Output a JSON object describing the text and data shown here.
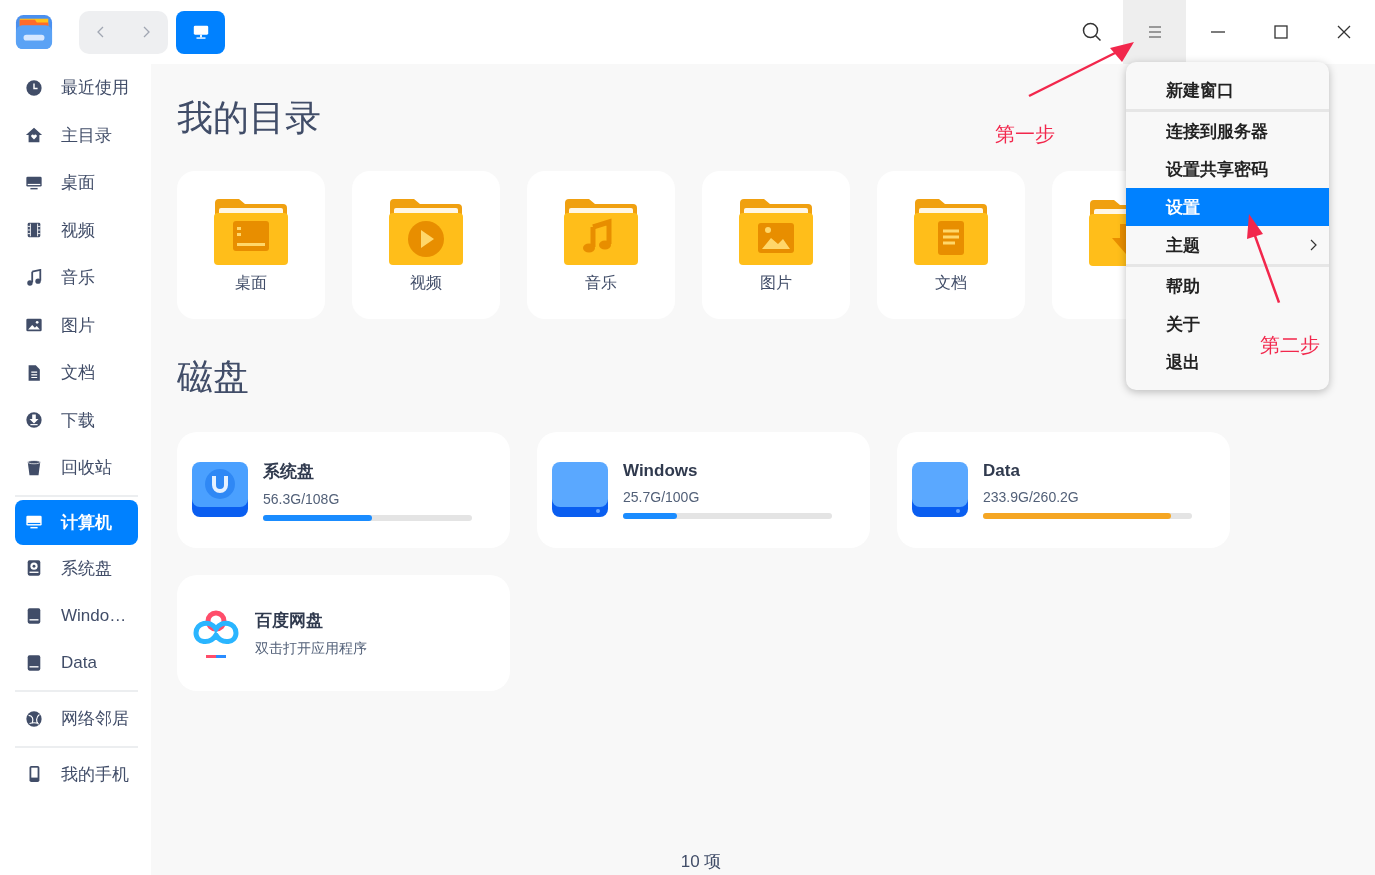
{
  "toolbar": {
    "menu_open": true
  },
  "sidebar": {
    "groups": [
      [
        {
          "label": "最近使用",
          "selected": false
        },
        {
          "label": "主目录",
          "selected": false
        },
        {
          "label": "桌面",
          "selected": false
        },
        {
          "label": "视频",
          "selected": false
        },
        {
          "label": "音乐",
          "selected": false
        },
        {
          "label": "图片",
          "selected": false
        },
        {
          "label": "文档",
          "selected": false
        },
        {
          "label": "下载",
          "selected": false
        },
        {
          "label": "回收站",
          "selected": false
        }
      ],
      [
        {
          "label": "计算机",
          "selected": true
        },
        {
          "label": "系统盘",
          "selected": false
        },
        {
          "label": "Windo…",
          "selected": false
        },
        {
          "label": "Data",
          "selected": false
        }
      ],
      [
        {
          "label": "网络邻居",
          "selected": false
        }
      ],
      [
        {
          "label": "我的手机",
          "selected": false
        }
      ]
    ]
  },
  "main": {
    "folders_title": "我的目录",
    "folders": [
      {
        "label": "桌面"
      },
      {
        "label": "视频"
      },
      {
        "label": "音乐"
      },
      {
        "label": "图片"
      },
      {
        "label": "文档"
      },
      {
        "kind": "covered"
      }
    ],
    "disks_title": "磁盘",
    "disks": [
      {
        "kind": "system",
        "name": "系统盘",
        "usage": "56.3G/108G",
        "level": 0.52,
        "color": "#1a8cff"
      },
      {
        "kind": "disk",
        "name": "Windows",
        "usage": "25.7G/100G",
        "level": 0.26,
        "color": "#1a8cff"
      },
      {
        "kind": "disk",
        "name": "Data",
        "usage": "233.9G/260.2G",
        "level": 0.9,
        "color": "#f5a623"
      },
      {
        "kind": "app",
        "name": "百度网盘",
        "subtitle": "双击打开应用程序"
      }
    ],
    "status": "10 项"
  },
  "menu": {
    "groups": [
      [
        {
          "label": "新建窗口",
          "selected": false,
          "submenu": false
        }
      ],
      [
        {
          "label": "连接到服务器",
          "selected": false,
          "submenu": false
        },
        {
          "label": "设置共享密码",
          "selected": false,
          "submenu": false
        },
        {
          "label": "设置",
          "selected": true,
          "submenu": false
        },
        {
          "label": "主题",
          "selected": false,
          "submenu": true
        }
      ],
      [
        {
          "label": "帮助",
          "selected": false,
          "submenu": false
        },
        {
          "label": "关于",
          "selected": false,
          "submenu": false
        },
        {
          "label": "退出",
          "selected": false,
          "submenu": false
        }
      ]
    ]
  },
  "annotations": [
    {
      "text": "第一步"
    },
    {
      "text": "第二步"
    }
  ]
}
